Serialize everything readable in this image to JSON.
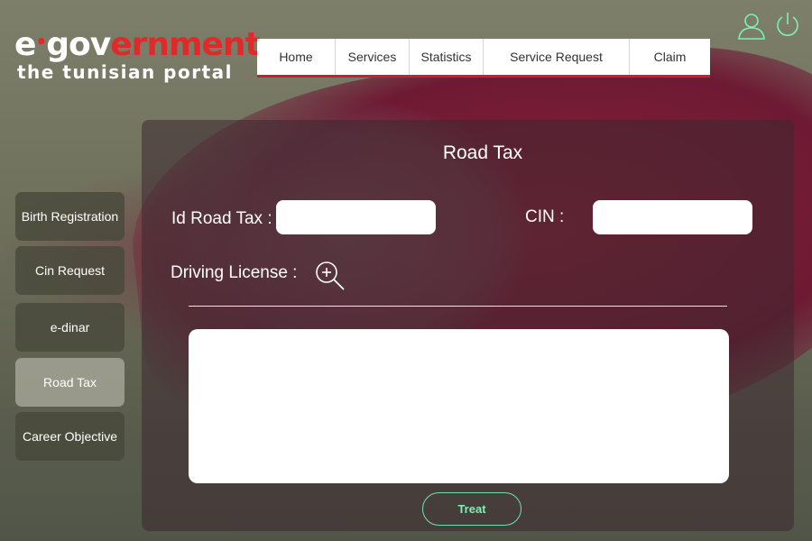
{
  "logo": {
    "line1_e": "e",
    "line1_dot": "•",
    "line1_gov": "gov",
    "line1_ernment": "ernment",
    "line2": "the tunisian portal"
  },
  "nav": {
    "items": [
      "Home",
      "Services",
      "Statistics",
      "Service Request",
      "Claim"
    ]
  },
  "top_icons": [
    "user-icon",
    "power-icon"
  ],
  "sidebar": {
    "items": [
      "Birth Registration",
      "Cin Request",
      "e-dinar",
      "Road Tax",
      "Career Objective"
    ],
    "active": "Road Tax"
  },
  "form": {
    "title": "Road Tax",
    "id_road_tax_label": "Id Road Tax :",
    "id_road_tax_value": "",
    "cin_label": "CIN :",
    "cin_value": "",
    "driving_license_label": "Driving License :",
    "result_value": "",
    "treat_label": "Treat"
  },
  "colors": {
    "brand_red": "#e02a2a",
    "nav_underline": "#c8202c",
    "accent_green": "#7ff0b3"
  }
}
